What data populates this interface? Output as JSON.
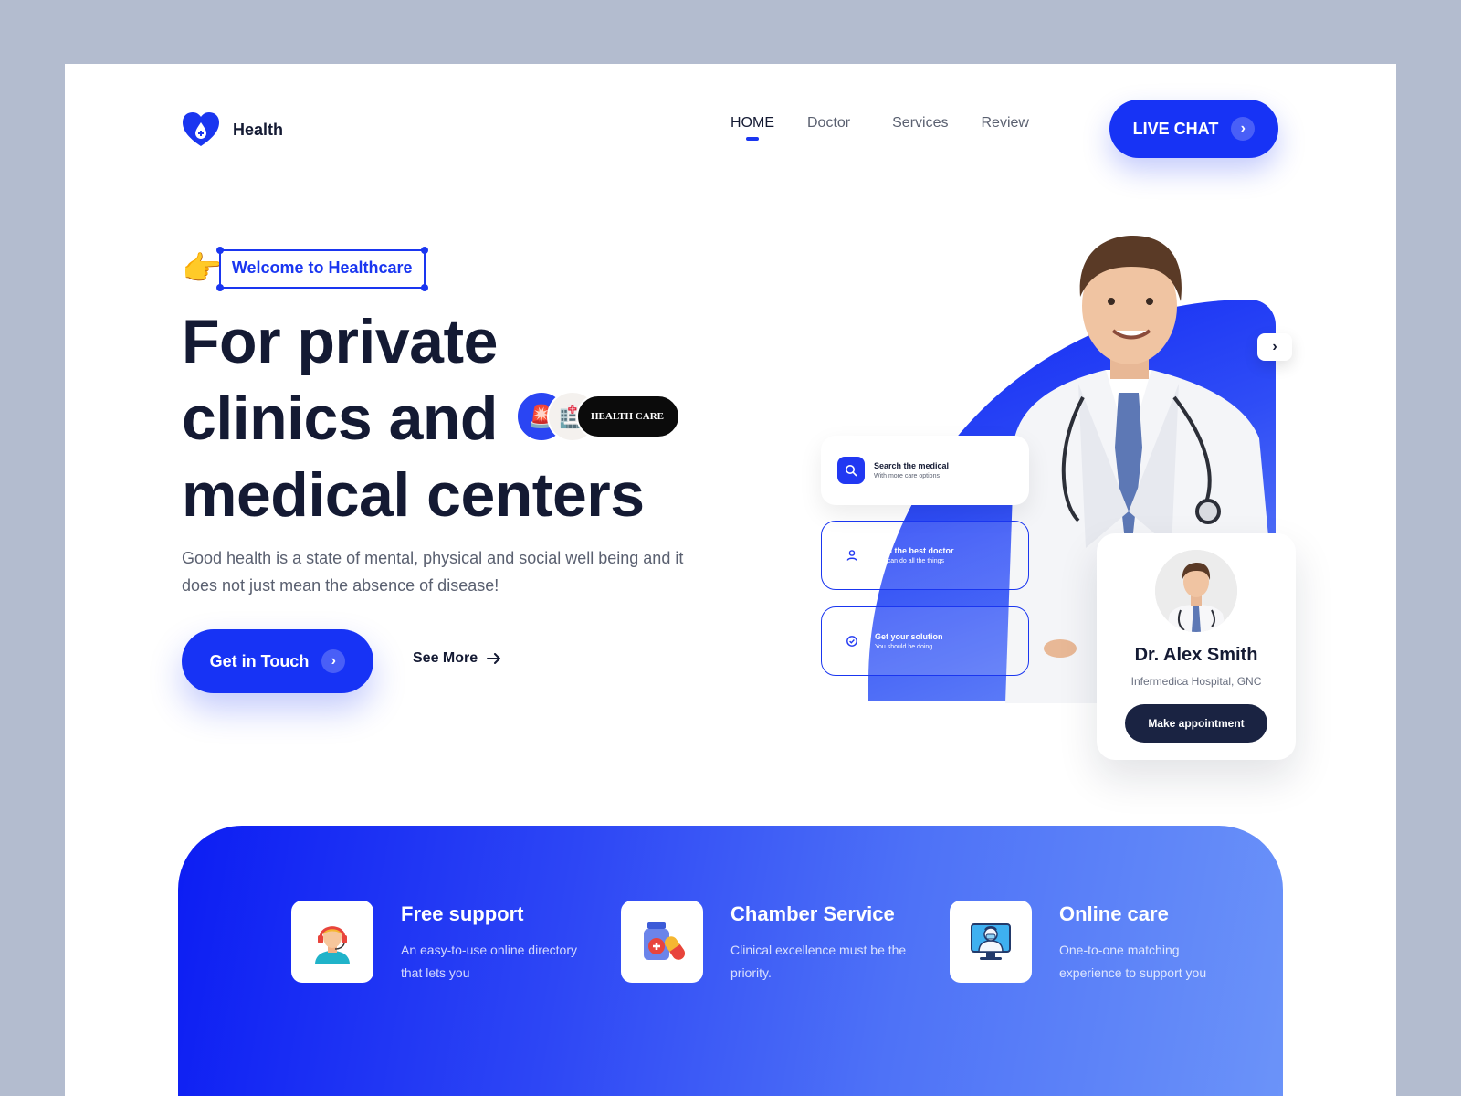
{
  "header": {
    "logo_text": "Health",
    "nav": [
      {
        "label": "HOME"
      },
      {
        "label": "Doctor"
      },
      {
        "label": "Services"
      },
      {
        "label": "Review"
      }
    ],
    "live_chat_label": "LIVE CHAT"
  },
  "hero": {
    "welcome": "Welcome to Healthcare",
    "title_lines": [
      "For private",
      "clinics and",
      "medical centers"
    ],
    "badge_label": "HEALTH CARE",
    "description": "Good health is a state of mental, physical and social well being and it does not just mean the absence of disease!",
    "cta_label": "Get in Touch",
    "see_more_label": "See More"
  },
  "cards": [
    {
      "title": "Search the medical",
      "subtitle": "With more care options",
      "icon": "search-icon"
    },
    {
      "title": "Find the best doctor",
      "subtitle": "You can do all the things",
      "icon": "user-icon"
    },
    {
      "title": "Get your solution",
      "subtitle": "You should be doing",
      "icon": "check-icon"
    }
  ],
  "doctor_card": {
    "name": "Dr. Alex Smith",
    "hospital": "Infermedica Hospital, GNC",
    "button_label": "Make appointment"
  },
  "features": [
    {
      "title": "Free support",
      "desc": "An easy-to-use online directory that lets you",
      "icon": "headset-support-icon"
    },
    {
      "title": "Chamber Service",
      "desc": "Clinical excellence must be the priority.",
      "icon": "medicine-bottle-icon"
    },
    {
      "title": "Online care",
      "desc": "One-to-one matching experience to support you",
      "icon": "online-doctor-icon"
    }
  ],
  "colors": {
    "primary": "#1733f5",
    "dark": "#141a33",
    "card_button": "#1a2342",
    "background": "#b3bccf"
  }
}
